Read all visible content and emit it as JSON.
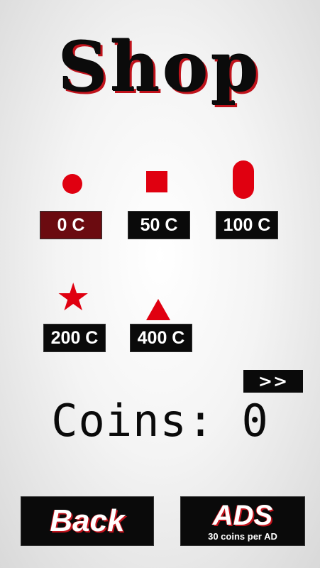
{
  "title": "Shop",
  "items": [
    {
      "shape": "circle-icon",
      "price_label": "0 C",
      "price": 0,
      "selected": true
    },
    {
      "shape": "square-icon",
      "price_label": "50 C",
      "price": 50,
      "selected": false
    },
    {
      "shape": "capsule-icon",
      "price_label": "100 C",
      "price": 100,
      "selected": false
    },
    {
      "shape": "star-icon",
      "price_label": "200 C",
      "price": 200,
      "selected": false
    },
    {
      "shape": "triangle-icon",
      "price_label": "400 C",
      "price": 400,
      "selected": false
    }
  ],
  "next_label": ">>",
  "coins_label": "Coins: 0",
  "coins": 0,
  "back_label": "Back",
  "ads_label": "ADS",
  "ads_sub": "30 coins per AD",
  "colors": {
    "accent": "#e00010",
    "dark": "#0a0a0a",
    "selected": "#6b0b10"
  }
}
